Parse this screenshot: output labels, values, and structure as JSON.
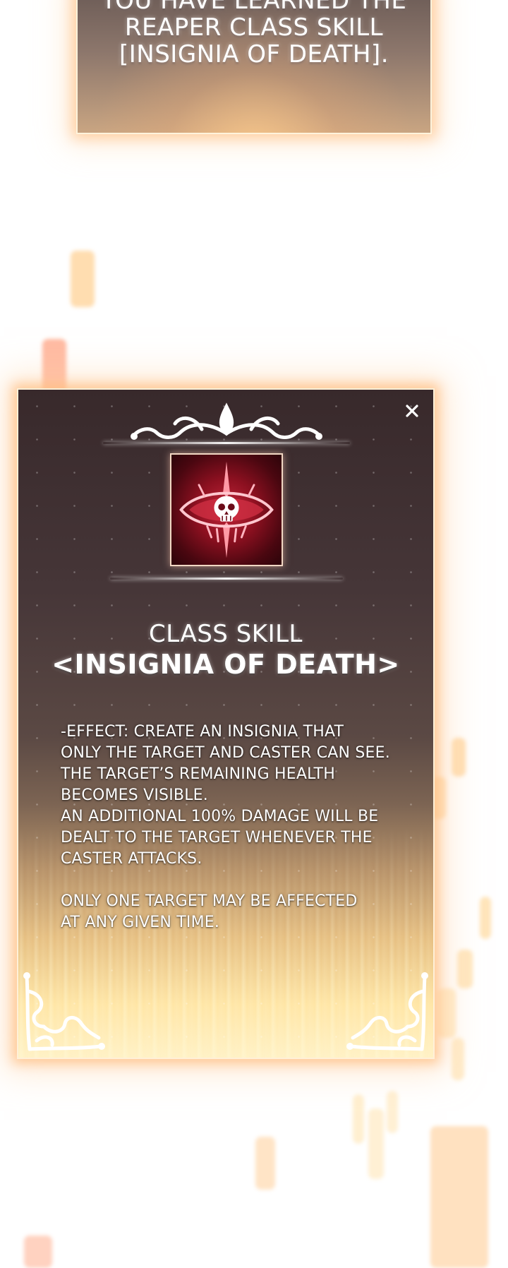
{
  "notification": {
    "lines": [
      "YOU HAVE LEARNED THE",
      "REAPER CLASS SKILL",
      "[INSIGNIA OF DEATH]."
    ]
  },
  "skill_window": {
    "close_label": "×",
    "icon_name": "skull-eye-insignia-icon",
    "class_label": "CLASS SKILL",
    "skill_name": "<INSIGNIA OF DEATH>",
    "description_lines": [
      "-EFFECT: CREATE AN INSIGNIA THAT",
      "ONLY THE TARGET AND CASTER CAN SEE.",
      "THE TARGET’S REMAINING HEALTH",
      "BECOMES VISIBLE.",
      "AN ADDITIONAL 100% DAMAGE WILL BE",
      "DEALT TO THE TARGET WHENEVER THE",
      "CASTER ATTACKS."
    ],
    "note_lines": [
      "ONLY ONE TARGET MAY BE AFFECTED",
      "AT ANY GIVEN TIME."
    ]
  },
  "colors": {
    "glow": "#ffc48c",
    "panel_dark": "#38292b",
    "icon_red": "#c4263a",
    "text": "#ffffff"
  }
}
